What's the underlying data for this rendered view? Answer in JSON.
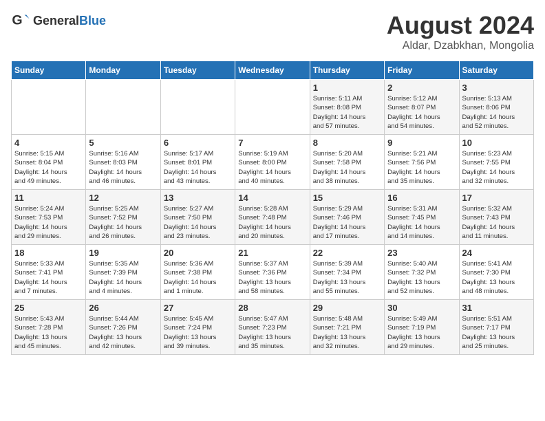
{
  "logo": {
    "text_general": "General",
    "text_blue": "Blue"
  },
  "title": "August 2024",
  "subtitle": "Aldar, Dzabkhan, Mongolia",
  "days_of_week": [
    "Sunday",
    "Monday",
    "Tuesday",
    "Wednesday",
    "Thursday",
    "Friday",
    "Saturday"
  ],
  "weeks": [
    [
      {
        "day": "",
        "info": ""
      },
      {
        "day": "",
        "info": ""
      },
      {
        "day": "",
        "info": ""
      },
      {
        "day": "",
        "info": ""
      },
      {
        "day": "1",
        "info": "Sunrise: 5:11 AM\nSunset: 8:08 PM\nDaylight: 14 hours\nand 57 minutes."
      },
      {
        "day": "2",
        "info": "Sunrise: 5:12 AM\nSunset: 8:07 PM\nDaylight: 14 hours\nand 54 minutes."
      },
      {
        "day": "3",
        "info": "Sunrise: 5:13 AM\nSunset: 8:06 PM\nDaylight: 14 hours\nand 52 minutes."
      }
    ],
    [
      {
        "day": "4",
        "info": "Sunrise: 5:15 AM\nSunset: 8:04 PM\nDaylight: 14 hours\nand 49 minutes."
      },
      {
        "day": "5",
        "info": "Sunrise: 5:16 AM\nSunset: 8:03 PM\nDaylight: 14 hours\nand 46 minutes."
      },
      {
        "day": "6",
        "info": "Sunrise: 5:17 AM\nSunset: 8:01 PM\nDaylight: 14 hours\nand 43 minutes."
      },
      {
        "day": "7",
        "info": "Sunrise: 5:19 AM\nSunset: 8:00 PM\nDaylight: 14 hours\nand 40 minutes."
      },
      {
        "day": "8",
        "info": "Sunrise: 5:20 AM\nSunset: 7:58 PM\nDaylight: 14 hours\nand 38 minutes."
      },
      {
        "day": "9",
        "info": "Sunrise: 5:21 AM\nSunset: 7:56 PM\nDaylight: 14 hours\nand 35 minutes."
      },
      {
        "day": "10",
        "info": "Sunrise: 5:23 AM\nSunset: 7:55 PM\nDaylight: 14 hours\nand 32 minutes."
      }
    ],
    [
      {
        "day": "11",
        "info": "Sunrise: 5:24 AM\nSunset: 7:53 PM\nDaylight: 14 hours\nand 29 minutes."
      },
      {
        "day": "12",
        "info": "Sunrise: 5:25 AM\nSunset: 7:52 PM\nDaylight: 14 hours\nand 26 minutes."
      },
      {
        "day": "13",
        "info": "Sunrise: 5:27 AM\nSunset: 7:50 PM\nDaylight: 14 hours\nand 23 minutes."
      },
      {
        "day": "14",
        "info": "Sunrise: 5:28 AM\nSunset: 7:48 PM\nDaylight: 14 hours\nand 20 minutes."
      },
      {
        "day": "15",
        "info": "Sunrise: 5:29 AM\nSunset: 7:46 PM\nDaylight: 14 hours\nand 17 minutes."
      },
      {
        "day": "16",
        "info": "Sunrise: 5:31 AM\nSunset: 7:45 PM\nDaylight: 14 hours\nand 14 minutes."
      },
      {
        "day": "17",
        "info": "Sunrise: 5:32 AM\nSunset: 7:43 PM\nDaylight: 14 hours\nand 11 minutes."
      }
    ],
    [
      {
        "day": "18",
        "info": "Sunrise: 5:33 AM\nSunset: 7:41 PM\nDaylight: 14 hours\nand 7 minutes."
      },
      {
        "day": "19",
        "info": "Sunrise: 5:35 AM\nSunset: 7:39 PM\nDaylight: 14 hours\nand 4 minutes."
      },
      {
        "day": "20",
        "info": "Sunrise: 5:36 AM\nSunset: 7:38 PM\nDaylight: 14 hours\nand 1 minute."
      },
      {
        "day": "21",
        "info": "Sunrise: 5:37 AM\nSunset: 7:36 PM\nDaylight: 13 hours\nand 58 minutes."
      },
      {
        "day": "22",
        "info": "Sunrise: 5:39 AM\nSunset: 7:34 PM\nDaylight: 13 hours\nand 55 minutes."
      },
      {
        "day": "23",
        "info": "Sunrise: 5:40 AM\nSunset: 7:32 PM\nDaylight: 13 hours\nand 52 minutes."
      },
      {
        "day": "24",
        "info": "Sunrise: 5:41 AM\nSunset: 7:30 PM\nDaylight: 13 hours\nand 48 minutes."
      }
    ],
    [
      {
        "day": "25",
        "info": "Sunrise: 5:43 AM\nSunset: 7:28 PM\nDaylight: 13 hours\nand 45 minutes."
      },
      {
        "day": "26",
        "info": "Sunrise: 5:44 AM\nSunset: 7:26 PM\nDaylight: 13 hours\nand 42 minutes."
      },
      {
        "day": "27",
        "info": "Sunrise: 5:45 AM\nSunset: 7:24 PM\nDaylight: 13 hours\nand 39 minutes."
      },
      {
        "day": "28",
        "info": "Sunrise: 5:47 AM\nSunset: 7:23 PM\nDaylight: 13 hours\nand 35 minutes."
      },
      {
        "day": "29",
        "info": "Sunrise: 5:48 AM\nSunset: 7:21 PM\nDaylight: 13 hours\nand 32 minutes."
      },
      {
        "day": "30",
        "info": "Sunrise: 5:49 AM\nSunset: 7:19 PM\nDaylight: 13 hours\nand 29 minutes."
      },
      {
        "day": "31",
        "info": "Sunrise: 5:51 AM\nSunset: 7:17 PM\nDaylight: 13 hours\nand 25 minutes."
      }
    ]
  ]
}
